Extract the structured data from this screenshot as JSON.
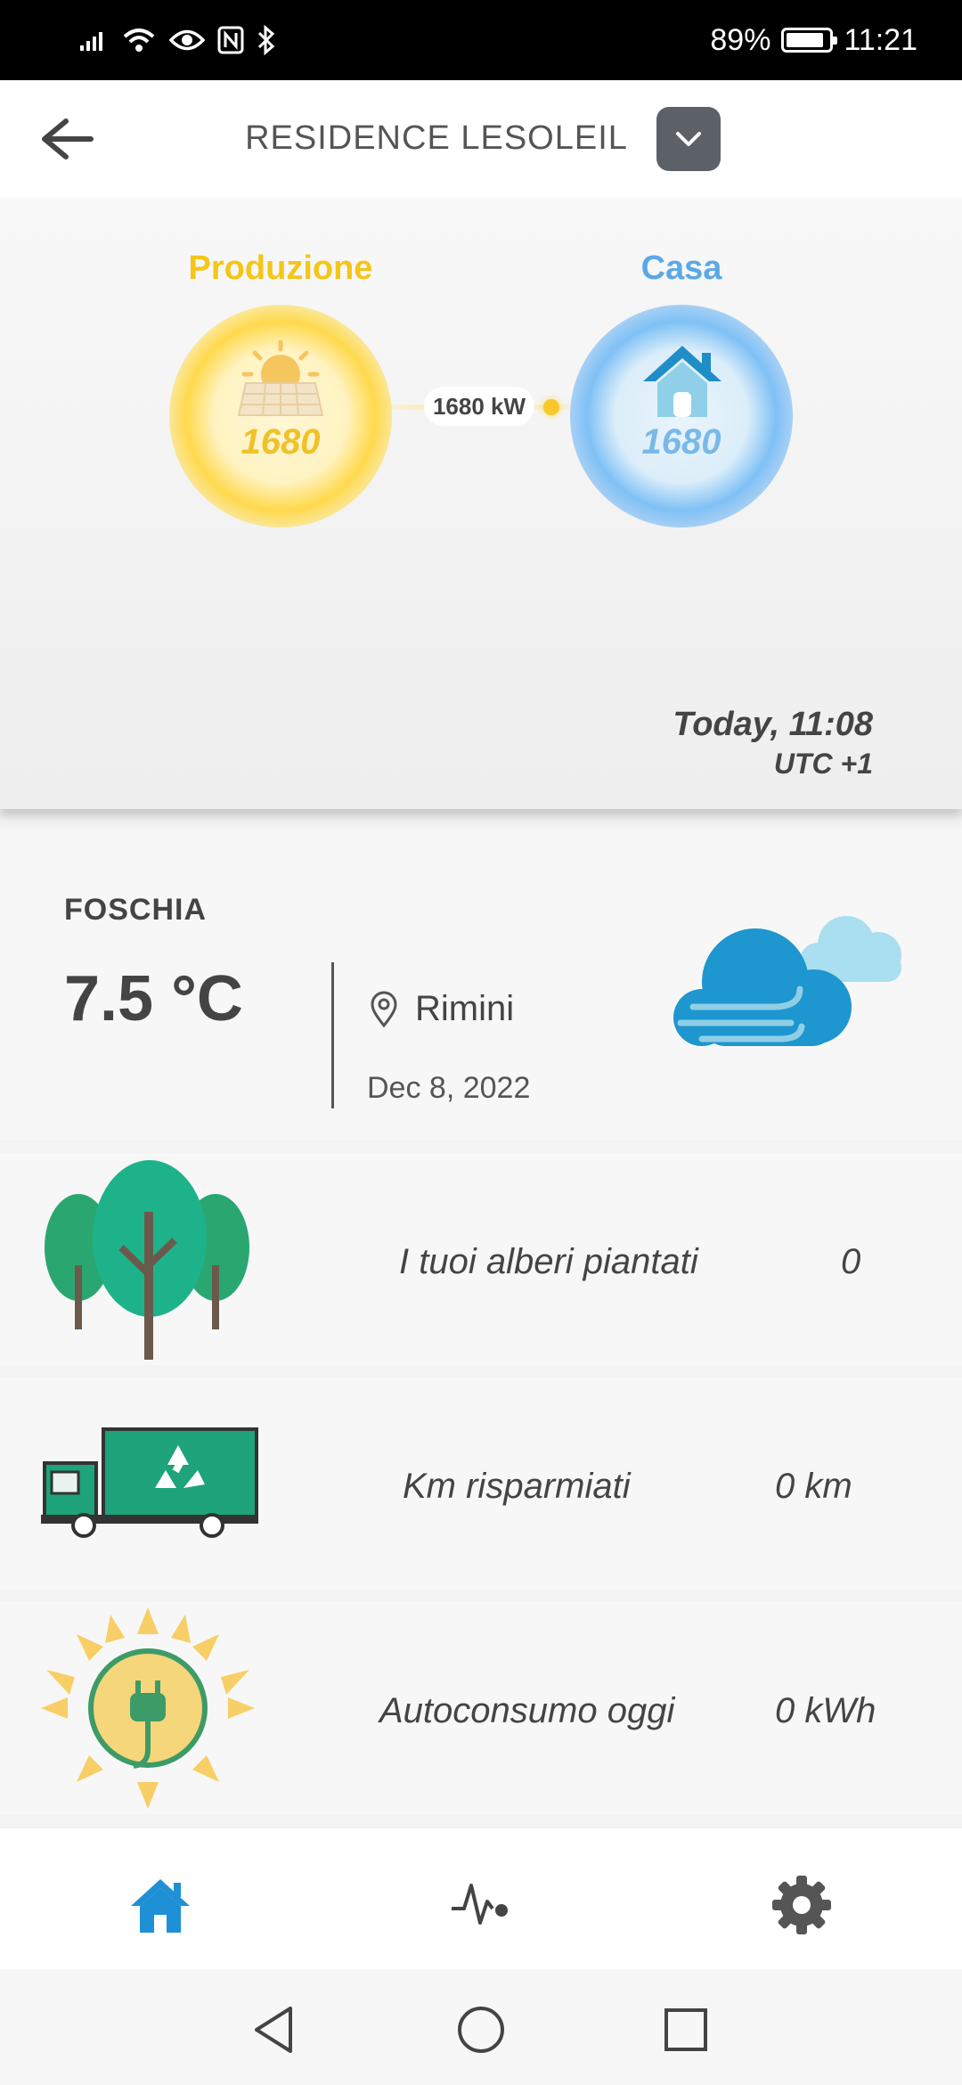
{
  "status_bar": {
    "battery": "89%",
    "battery_level": 0.89,
    "time": "11:21"
  },
  "header": {
    "title": "RESIDENCE LESOLEIL"
  },
  "energy": {
    "production_label": "Produzione",
    "production_value": "1680",
    "home_label": "Casa",
    "home_value": "1680",
    "flow_value": "1680 kW",
    "updated": "Today, 11:08",
    "timezone": "UTC +1",
    "colors": {
      "production": "#f5c518",
      "home": "#5aa9e6"
    }
  },
  "weather": {
    "condition": "FOSCHIA",
    "temperature": "7.5 °C",
    "location": "Rimini",
    "date": "Dec 8, 2022"
  },
  "stats": [
    {
      "label": "I tuoi alberi piantati",
      "value": "0",
      "icon": "trees-icon"
    },
    {
      "label": "Km risparmiati",
      "value": "0 km",
      "icon": "recycle-truck-icon"
    },
    {
      "label": "Autoconsumo oggi",
      "value": "0 kWh",
      "icon": "sun-plug-icon"
    }
  ],
  "bottom_nav": {
    "items": [
      "home-icon",
      "activity-icon",
      "settings-icon"
    ],
    "active": "home-icon",
    "active_color": "#1e90d6"
  }
}
